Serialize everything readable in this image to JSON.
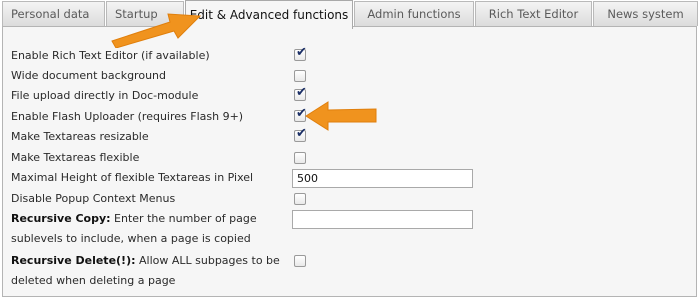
{
  "tabs": [
    {
      "label": "Personal data",
      "active": false
    },
    {
      "label": "Startup",
      "active": false
    },
    {
      "label": "Edit & Advanced functions",
      "active": true
    },
    {
      "label": "Admin functions",
      "active": false
    },
    {
      "label": "Rich Text Editor",
      "active": false
    },
    {
      "label": "News system",
      "active": false
    }
  ],
  "settings": {
    "rich_text_editor": {
      "label": "Enable Rich Text Editor (if available)",
      "checked": true
    },
    "wide_background": {
      "label": "Wide document background",
      "checked": false
    },
    "file_upload_doc": {
      "label": "File upload directly in Doc-module",
      "checked": true
    },
    "flash_uploader": {
      "label": "Enable Flash Uploader (requires Flash 9+)",
      "checked": true
    },
    "textarea_resizable": {
      "label": "Make Textareas resizable",
      "checked": true
    },
    "textarea_flexible": {
      "label": "Make Textareas flexible",
      "checked": false
    },
    "max_height": {
      "label": "Maximal Height of flexible Textareas in Pixel",
      "value": "500"
    },
    "disable_context_menus": {
      "label": "Disable Popup Context Menus",
      "checked": false
    },
    "recursive_copy": {
      "label_bold": "Recursive Copy:",
      "label_rest": " Enter the number of page sublevels to include, when a page is copied",
      "value": ""
    },
    "recursive_delete": {
      "label_bold": "Recursive Delete(!):",
      "label_rest": " Allow ALL subpages to be deleted when deleting a page",
      "checked": false
    }
  },
  "colors": {
    "arrow": "#f0931e",
    "check": "#1b2f66",
    "panel": "#f6f6f6"
  },
  "icons": {
    "checkmark": "checkmark-icon",
    "arrow": "pointer-arrow-icon"
  }
}
